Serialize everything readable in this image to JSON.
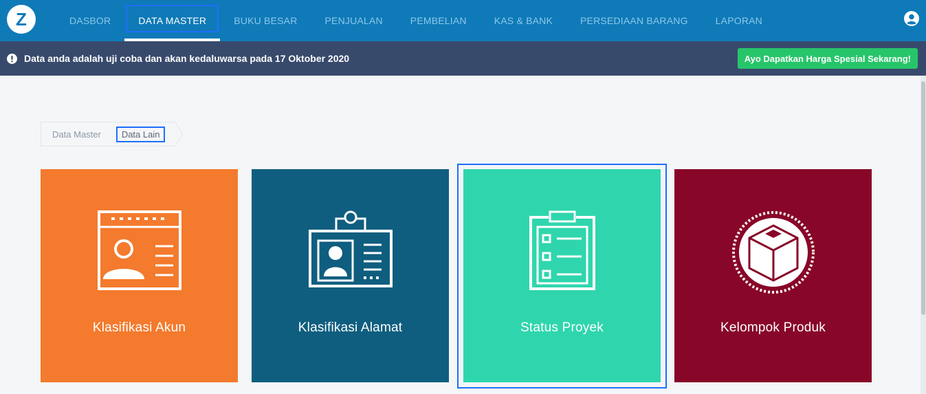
{
  "app": {
    "logo_letter": "Z"
  },
  "nav": {
    "items": [
      {
        "label": "DASBOR",
        "active": false
      },
      {
        "label": "DATA MASTER",
        "active": true
      },
      {
        "label": "BUKU BESAR",
        "active": false
      },
      {
        "label": "PENJUALAN",
        "active": false
      },
      {
        "label": "PEMBELIAN",
        "active": false
      },
      {
        "label": "KAS & BANK",
        "active": false
      },
      {
        "label": "PERSEDIAAN BARANG",
        "active": false
      },
      {
        "label": "LAPORAN",
        "active": false
      }
    ]
  },
  "notice": {
    "text": "Data anda adalah uji coba dan akan kedaluwarsa pada 17 Oktober 2020",
    "button_label": "Ayo Dapatkan Harga Spesial Sekarang!"
  },
  "breadcrumb": {
    "items": [
      "Data Master",
      "Data Lain"
    ]
  },
  "cards": [
    {
      "label": "Klasifikasi Akun",
      "color": "#f47a2d",
      "icon": "account-card-icon"
    },
    {
      "label": "Klasifikasi Alamat",
      "color": "#0f5e7f",
      "icon": "id-badge-icon"
    },
    {
      "label": "Status Proyek",
      "color": "#2fd6ad",
      "icon": "clipboard-checklist-icon"
    },
    {
      "label": "Kelompok Produk",
      "color": "#880628",
      "icon": "product-box-icon"
    }
  ],
  "colors": {
    "topbar": "#0f7ab8",
    "notice_bar": "#384a6c",
    "promo_button": "#27c56a",
    "focus": "#1e6fff"
  }
}
